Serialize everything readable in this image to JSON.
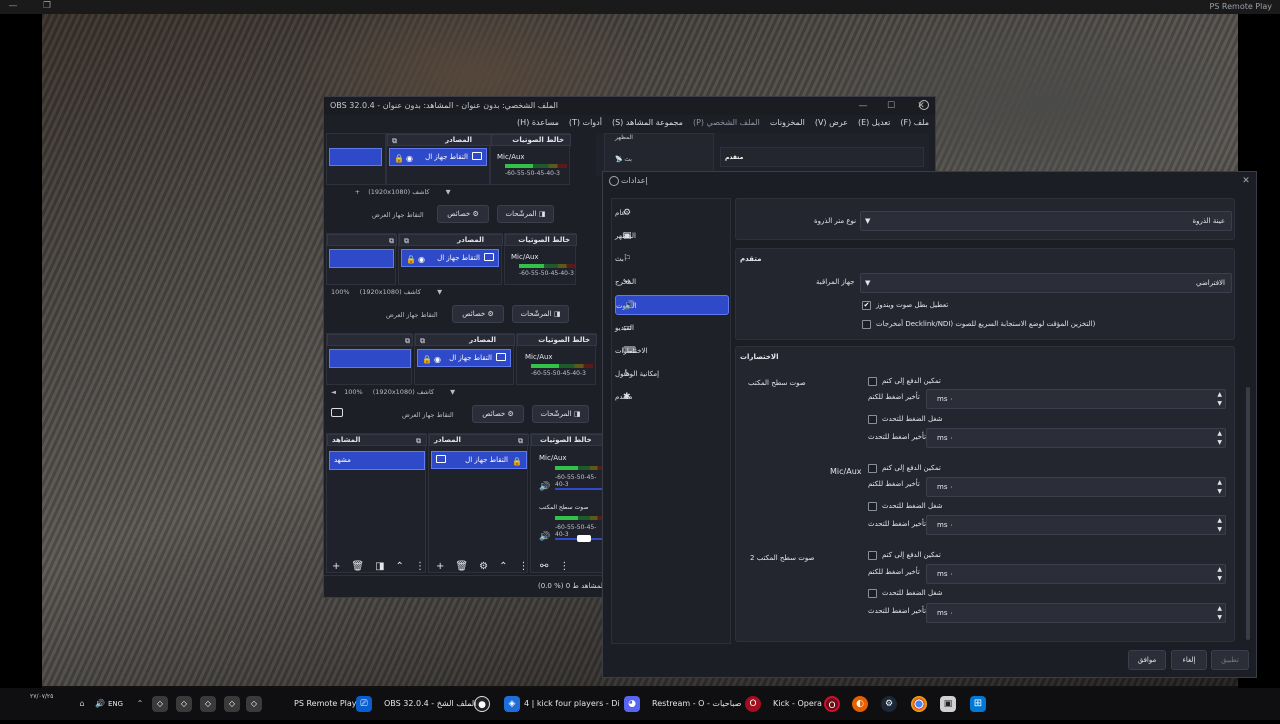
{
  "ps_remote": {
    "title": "PS Remote Play"
  },
  "obs": {
    "title": "OBS 32.0.4 - الملف الشخصي: بدون عنوان - المشاهد: بدون عنوان",
    "menu": [
      "ملف (F)",
      "تعديل (E)",
      "عرض (V)",
      "المخزونات",
      "الملف الشخصي (P)",
      "مجموعة المشاهد (S)",
      "أدوات (T)",
      "مساعدة (H)"
    ],
    "docks": {
      "scenes": "المشاهد",
      "sources": "المصادر",
      "mixer": "خالط الصوتيات",
      "scene_item": "مشهد",
      "source_item": "التقاط جهاز ال",
      "mic_aux": "Mic/Aux",
      "desktop_audio": "صوت سطح المكتب",
      "meter_ticks": "-60-55-50-45-40-3",
      "resolution_1": "(1920x1080) كاشف",
      "resolution_2": "(1920x1080) كاشف",
      "zoom": "100%",
      "properties": "خصائص",
      "filters": "المرشّحات",
      "display_capture": "التقاط جهاز العرض",
      "status": "(0.0 %) 0 المشاهد ط",
      "stream_label": "بث",
      "appearance_label": "المظهر",
      "advanced_label": "متقدم"
    }
  },
  "settings": {
    "title": "إعدادات",
    "nav": [
      "عام",
      "المظهر",
      "بث",
      "المخرج",
      "الصوت",
      "الفيديو",
      "الاختصارات",
      "إمكانية الوصول",
      "متقدم"
    ],
    "nav_icons": [
      "gear-icon",
      "palette-icon",
      "broadcast-icon",
      "output-icon",
      "speaker-icon",
      "video-icon",
      "keyboard-icon",
      "accessibility-icon",
      "tools-icon"
    ],
    "selected_nav": "الصوت",
    "peak_meter_label": "نوع متر الذروة",
    "peak_meter_value": "عينة الذروة",
    "advanced_title": "متقدم",
    "monitor_device_label": "جهاز المراقبة",
    "monitor_device_value": "الافتراضي",
    "disable_ducking": "تعطيل بطل صوت ويندوز",
    "disable_ducking_checked": true,
    "low_latency": "أمخرجات Decklink/NDI) التخزين المؤقت لوضع الاستجابة السريع للصوت)",
    "low_latency_checked": false,
    "hotkeys_title": "الاختصارات",
    "enable_ptm": "تمكين الدفع إلى كتم",
    "ptm_delay": "تأخير اضغط للكتم",
    "enable_ptt": "شغل الضغط للتحدث",
    "ptt_delay": "تأخير اضغط للتحدث",
    "ms_value": "ms ٠",
    "sources": [
      "صوت سطح المكتب",
      "Mic/Aux",
      "صوت سطح المكتب 2"
    ],
    "ok": "موافق",
    "cancel": "إلغاء",
    "apply": "تطبيق"
  },
  "taskbar": {
    "items": [
      "PS Remote Play",
      "OBS 32.0.4 - الملف الشخ",
      "4 | kick four players - Di",
      "Restream - O - صباحيات",
      "Kick - Opera"
    ],
    "lang": "ENG",
    "date": "٢٧/٠٧/٢٥"
  }
}
